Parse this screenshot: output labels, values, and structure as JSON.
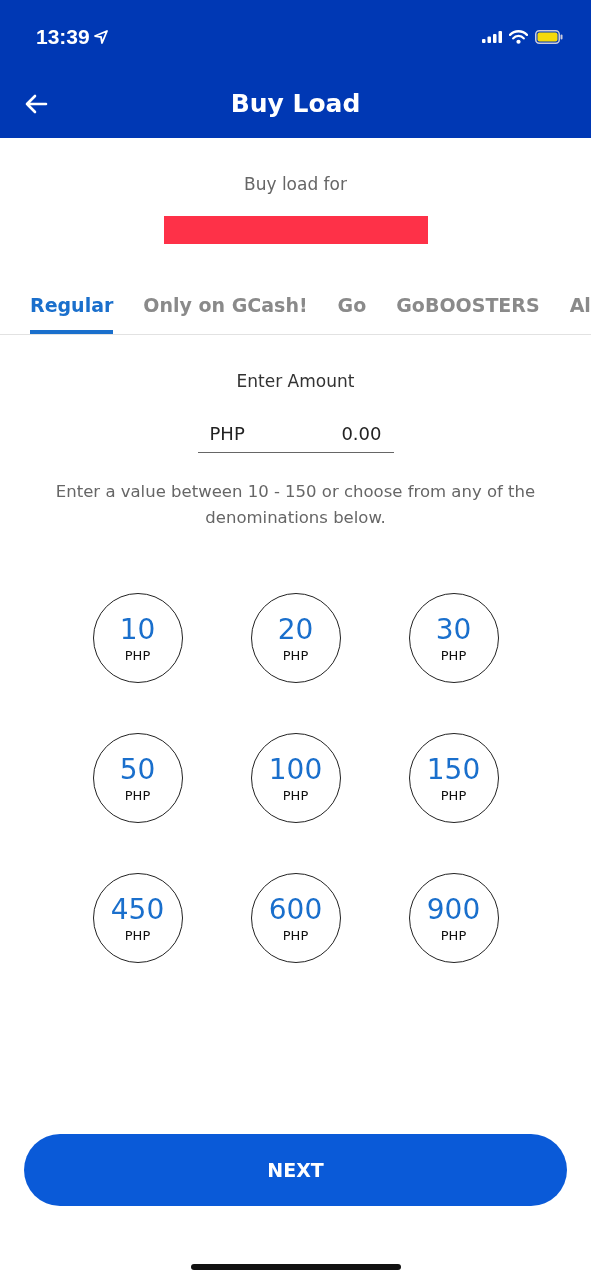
{
  "status_bar": {
    "time": "13:39"
  },
  "header": {
    "title": "Buy Load"
  },
  "recipient": {
    "label": "Buy load for"
  },
  "tabs": [
    {
      "label": "Regular",
      "selected": true
    },
    {
      "label": "Only on GCash!",
      "selected": false
    },
    {
      "label": "Go",
      "selected": false
    },
    {
      "label": "GoBOOSTERS",
      "selected": false
    },
    {
      "label": "Al",
      "selected": false
    }
  ],
  "amount": {
    "label": "Enter Amount",
    "currency": "PHP",
    "value": "0.00"
  },
  "hint": "Enter a value between 10 - 150 or choose from any of the denominations below.",
  "denominations": [
    {
      "amount": "10",
      "currency": "PHP"
    },
    {
      "amount": "20",
      "currency": "PHP"
    },
    {
      "amount": "30",
      "currency": "PHP"
    },
    {
      "amount": "50",
      "currency": "PHP"
    },
    {
      "amount": "100",
      "currency": "PHP"
    },
    {
      "amount": "150",
      "currency": "PHP"
    },
    {
      "amount": "450",
      "currency": "PHP"
    },
    {
      "amount": "600",
      "currency": "PHP"
    },
    {
      "amount": "900",
      "currency": "PHP"
    }
  ],
  "button": {
    "label": "NEXT"
  }
}
